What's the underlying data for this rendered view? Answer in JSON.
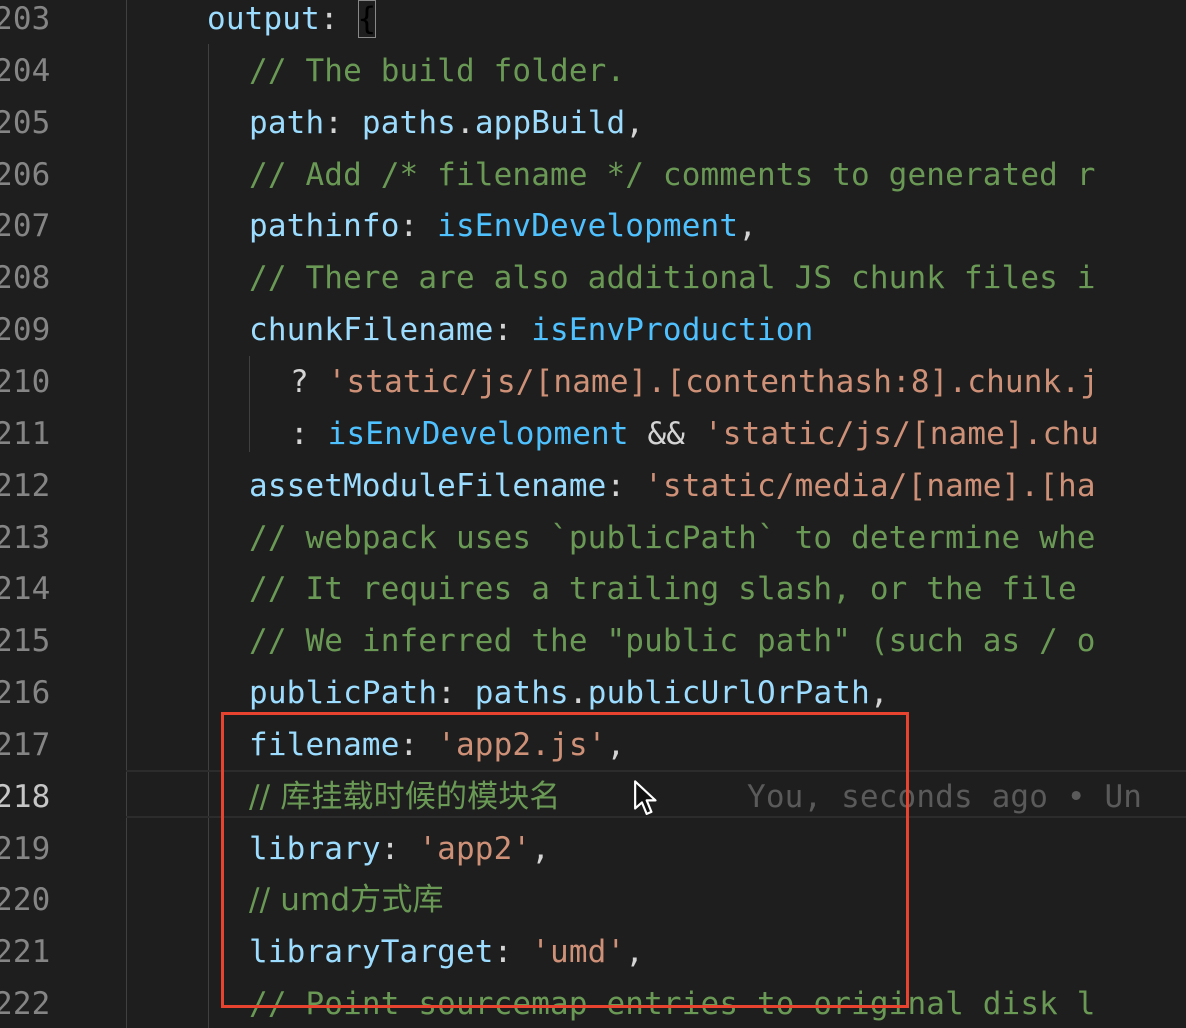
{
  "editor": {
    "lines": [
      {
        "num": "203",
        "tokens": [
          [
            "output",
            "t-key"
          ],
          [
            ": ",
            "t-punc"
          ],
          [
            "{",
            "bracket"
          ]
        ]
      },
      {
        "num": "204",
        "tokens": [
          [
            "// The build folder.",
            "t-comment"
          ]
        ]
      },
      {
        "num": "205",
        "tokens": [
          [
            "path",
            "t-key"
          ],
          [
            ": ",
            "t-punc"
          ],
          [
            "paths",
            "t-var"
          ],
          [
            ".",
            "t-punc"
          ],
          [
            "appBuild",
            "t-var"
          ],
          [
            ",",
            "t-punc"
          ]
        ]
      },
      {
        "num": "206",
        "tokens": [
          [
            "// Add /* filename */ comments to generated r",
            "t-comment"
          ]
        ]
      },
      {
        "num": "207",
        "tokens": [
          [
            "pathinfo",
            "t-key"
          ],
          [
            ": ",
            "t-punc"
          ],
          [
            "isEnvDevelopment",
            "t-const"
          ],
          [
            ",",
            "t-punc"
          ]
        ]
      },
      {
        "num": "208",
        "tokens": [
          [
            "// There are also additional JS chunk files i",
            "t-comment"
          ]
        ]
      },
      {
        "num": "209",
        "tokens": [
          [
            "chunkFilename",
            "t-key"
          ],
          [
            ": ",
            "t-punc"
          ],
          [
            "isEnvProduction",
            "t-const"
          ]
        ]
      },
      {
        "num": "210",
        "tokens": [
          [
            "? ",
            "t-op"
          ],
          [
            "'static/js/[name].[contenthash:8].chunk.j",
            "t-str"
          ]
        ]
      },
      {
        "num": "211",
        "tokens": [
          [
            ": ",
            "t-op"
          ],
          [
            "isEnvDevelopment",
            "t-const"
          ],
          [
            " && ",
            "t-op"
          ],
          [
            "'static/js/[name].chu",
            "t-str"
          ]
        ]
      },
      {
        "num": "212",
        "tokens": [
          [
            "assetModuleFilename",
            "t-key"
          ],
          [
            ": ",
            "t-punc"
          ],
          [
            "'static/media/[name].[ha",
            "t-str"
          ]
        ]
      },
      {
        "num": "213",
        "tokens": [
          [
            "// webpack uses `publicPath` to determine whe",
            "t-comment"
          ]
        ]
      },
      {
        "num": "214",
        "tokens": [
          [
            "// It requires a trailing slash, or the file ",
            "t-comment"
          ]
        ]
      },
      {
        "num": "215",
        "tokens": [
          [
            "// We inferred the \"public path\" (such as / o",
            "t-comment"
          ]
        ]
      },
      {
        "num": "216",
        "tokens": [
          [
            "publicPath",
            "t-key"
          ],
          [
            ": ",
            "t-punc"
          ],
          [
            "paths",
            "t-var"
          ],
          [
            ".",
            "t-punc"
          ],
          [
            "publicUrlOrPath",
            "t-var"
          ],
          [
            ",",
            "t-punc"
          ]
        ]
      },
      {
        "num": "217",
        "tokens": [
          [
            "filename",
            "t-key"
          ],
          [
            ": ",
            "t-punc"
          ],
          [
            "'app2.js'",
            "t-str"
          ],
          [
            ",",
            "t-punc"
          ]
        ]
      },
      {
        "num": "218",
        "tokens": [
          [
            "// 库挂载时候的模块名",
            "t-comment"
          ]
        ],
        "blame": "You, seconds ago • Un"
      },
      {
        "num": "219",
        "tokens": [
          [
            "library",
            "t-key"
          ],
          [
            ": ",
            "t-punc"
          ],
          [
            "'app2'",
            "t-str"
          ],
          [
            ",",
            "t-punc"
          ]
        ]
      },
      {
        "num": "220",
        "tokens": [
          [
            "// umd方式库",
            "t-comment"
          ]
        ]
      },
      {
        "num": "221",
        "tokens": [
          [
            "libraryTarget",
            "t-key"
          ],
          [
            ": ",
            "t-punc"
          ],
          [
            "'umd'",
            "t-str"
          ],
          [
            ",",
            "t-punc"
          ]
        ]
      },
      {
        "num": "222",
        "tokens": [
          [
            "// Point sourcemap entries to original disk l",
            "t-comment"
          ]
        ]
      }
    ],
    "current_line": "218",
    "colors": {
      "background": "#1e1e1e",
      "highlight_box": "#e8432f",
      "property": "#9cdcfe",
      "constant": "#4fc1ff",
      "string": "#ce9178",
      "comment": "#6a9955"
    }
  }
}
